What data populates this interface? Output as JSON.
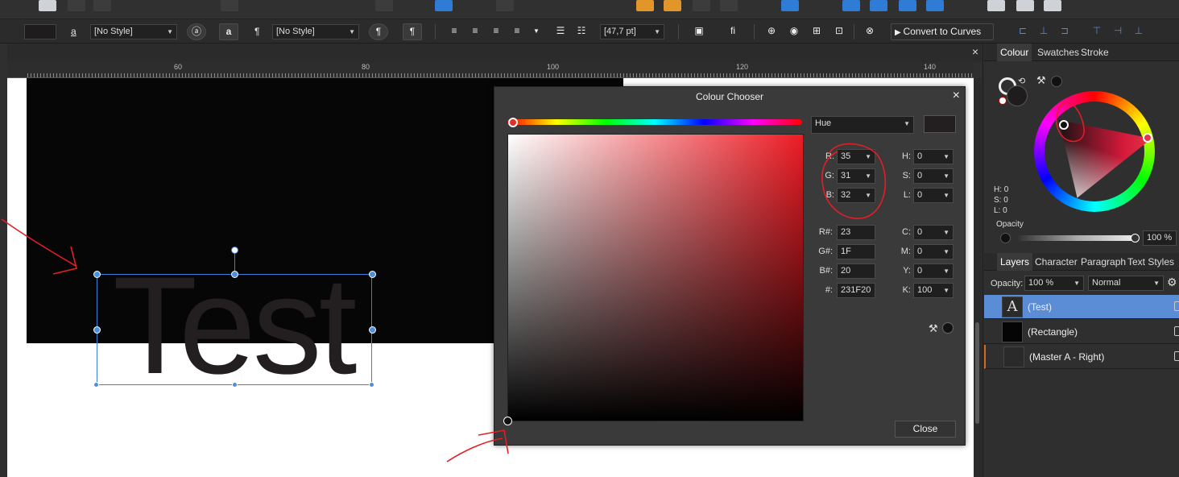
{
  "context_toolbar": {
    "char_style_label": "a",
    "char_style_value": "[No Style]",
    "char_btn_label": "a",
    "para_style_label": "¶",
    "para_style_value": "[No Style]",
    "para_btn_label": "¶",
    "font_size_value": "[47,7 pt]",
    "ligature_label": "fi",
    "convert_to_curves": "Convert to Curves"
  },
  "ruler": {
    "ticks": [
      "60",
      "80",
      "100",
      "120",
      "140"
    ]
  },
  "canvas": {
    "text_frame_content": "Test"
  },
  "colour_chooser": {
    "title": "Colour Chooser",
    "close_x": "×",
    "mode_value": "Hue",
    "rgb": {
      "r_label": "R:",
      "r": "35",
      "g_label": "G:",
      "g": "31",
      "b_label": "B:",
      "b": "32"
    },
    "hsl": {
      "h_label": "H:",
      "h": "0",
      "s_label": "S:",
      "s": "0",
      "l_label": "L:",
      "l": "0"
    },
    "hex": {
      "r_label": "R#:",
      "r": "23",
      "g_label": "G#:",
      "g": "1F",
      "b_label": "B#:",
      "b": "20",
      "hash_label": "#:",
      "hash": "231F20"
    },
    "cmyk": {
      "c_label": "C:",
      "c": "0",
      "m_label": "M:",
      "m": "0",
      "y_label": "Y:",
      "y": "0",
      "k_label": "K:",
      "k": "100"
    },
    "close_button": "Close",
    "preview_color": "#231f20"
  },
  "colour_panel": {
    "tabs": [
      "Colour",
      "Swatches",
      "Stroke"
    ],
    "h_readout": "H: 0",
    "s_readout": "S: 0",
    "l_readout": "L: 0",
    "opacity_label": "Opacity",
    "opacity_value": "100 %"
  },
  "layers_panel": {
    "tabs": [
      "Layers",
      "Character",
      "Paragraph",
      "Text Styles"
    ],
    "opacity_label": "Opacity:",
    "opacity_value": "100 %",
    "blend_mode": "Normal",
    "layers": [
      {
        "name": "(Test)",
        "thumb": "A"
      },
      {
        "name": "(Rectangle)",
        "thumb": ""
      },
      {
        "name": "(Master A - Right)",
        "thumb": ""
      }
    ]
  },
  "colors": {
    "accent": "#5b8dd6",
    "annotation": "#e21f26",
    "text_fill": "#231f20"
  }
}
